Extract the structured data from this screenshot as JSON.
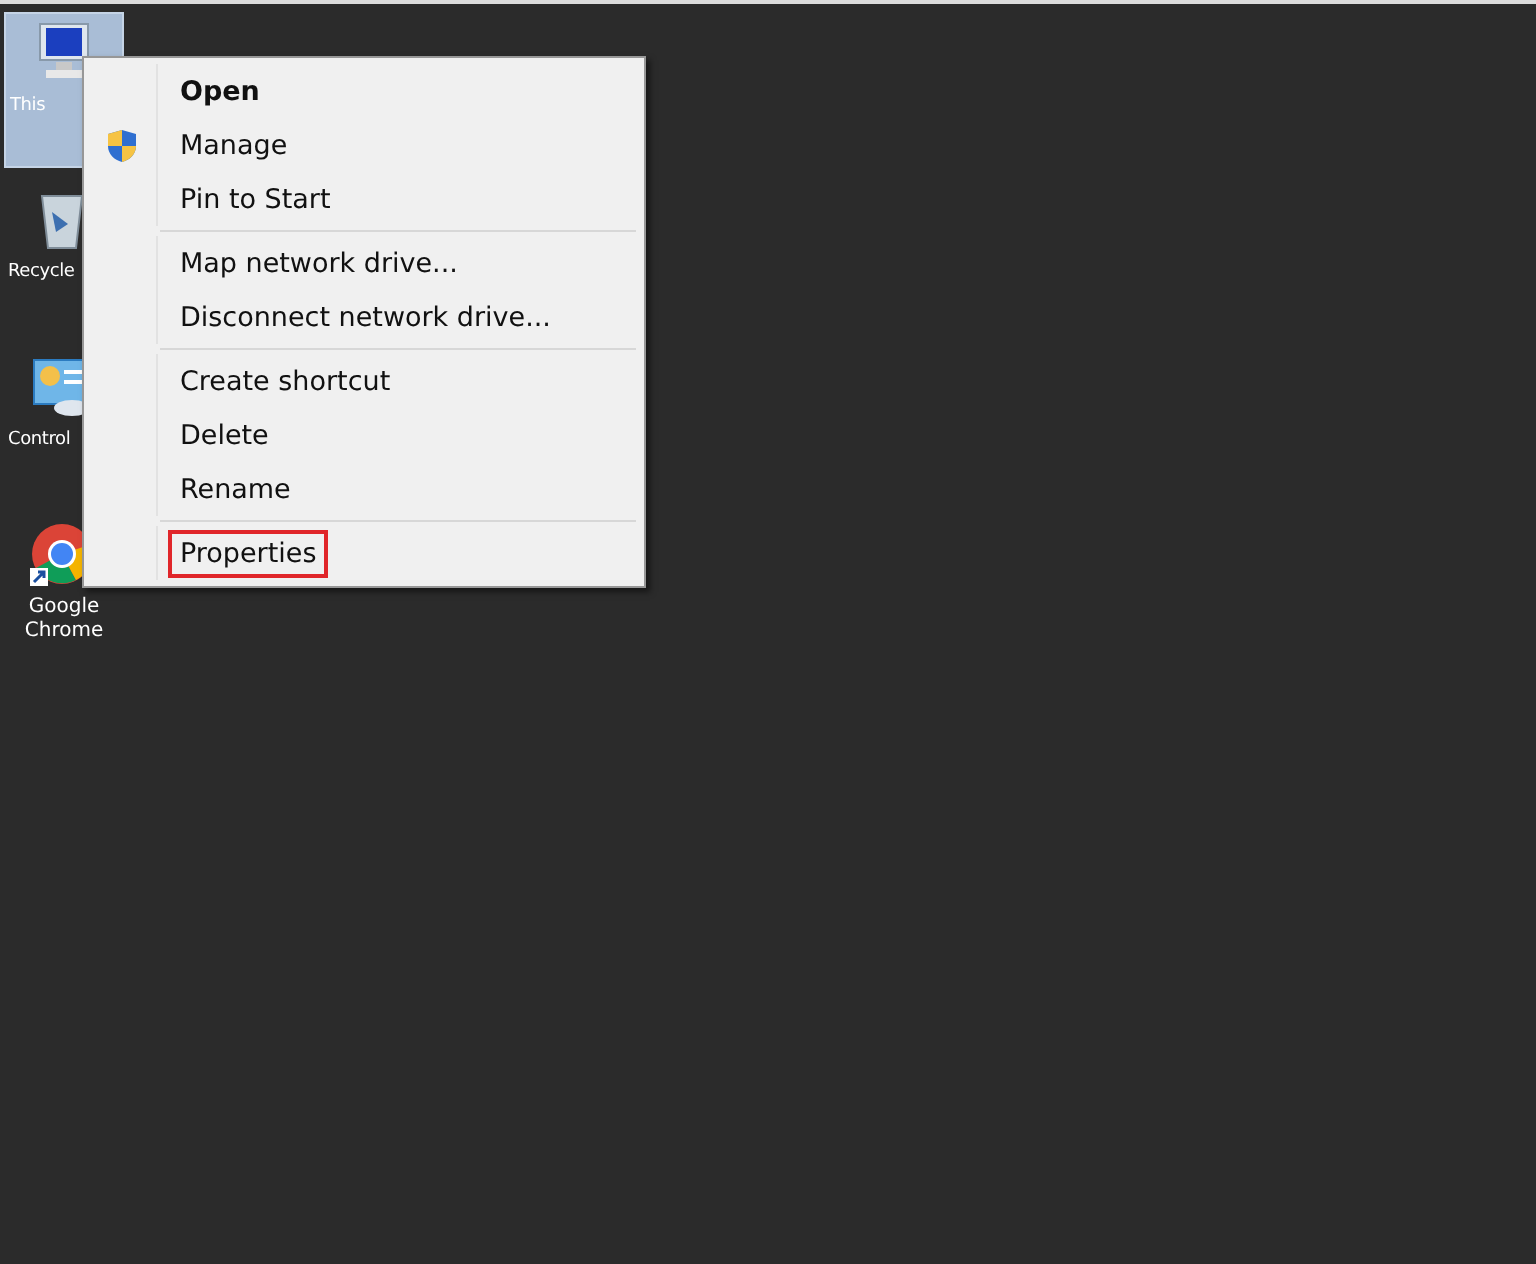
{
  "desktop_icons": [
    {
      "kind": "computer",
      "label": "This",
      "selected": true
    },
    {
      "kind": "recycle",
      "label": "Recycle",
      "selected": false
    },
    {
      "kind": "control",
      "label": "Control",
      "selected": false
    },
    {
      "kind": "chrome",
      "label": "Google Chrome",
      "selected": false
    }
  ],
  "context_menu": {
    "groups": [
      [
        {
          "kind": "plain",
          "label": "Open",
          "default": true,
          "outlined": false
        },
        {
          "kind": "shield",
          "label": "Manage",
          "default": false,
          "outlined": false
        },
        {
          "kind": "plain",
          "label": "Pin to Start",
          "default": false,
          "outlined": false
        }
      ],
      [
        {
          "kind": "plain",
          "label": "Map network drive...",
          "default": false,
          "outlined": false
        },
        {
          "kind": "plain",
          "label": "Disconnect network drive...",
          "default": false,
          "outlined": false
        }
      ],
      [
        {
          "kind": "plain",
          "label": "Create shortcut",
          "default": false,
          "outlined": false
        },
        {
          "kind": "plain",
          "label": "Delete",
          "default": false,
          "outlined": false
        },
        {
          "kind": "plain",
          "label": "Rename",
          "default": false,
          "outlined": false
        }
      ],
      [
        {
          "kind": "plain",
          "label": "Properties",
          "default": false,
          "outlined": true
        }
      ]
    ]
  }
}
